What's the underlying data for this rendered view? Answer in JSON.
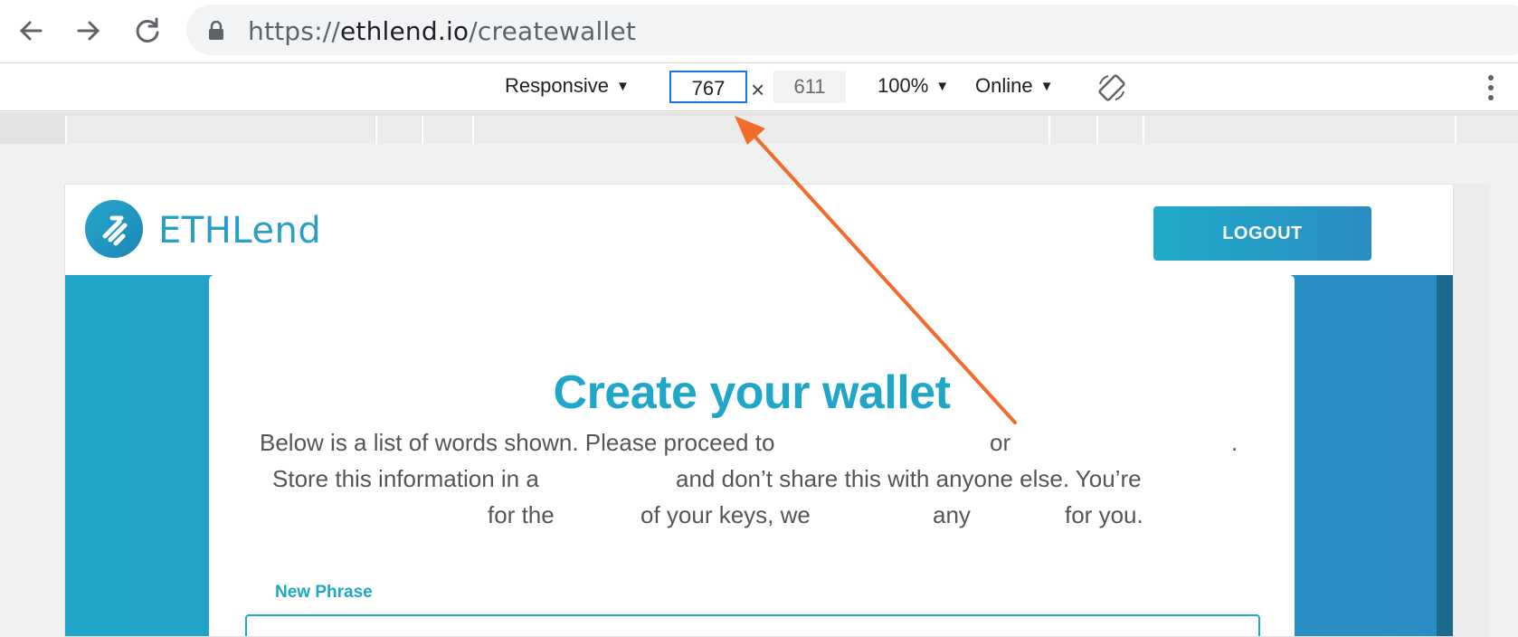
{
  "browser": {
    "url_scheme": "https://",
    "url_host": "ethlend.io",
    "url_path": "/createwallet"
  },
  "device_toolbar": {
    "mode": "Responsive",
    "width": "767",
    "times": "×",
    "height": "611",
    "zoom": "100%",
    "network": "Online"
  },
  "app": {
    "logo_text": "ETHLend",
    "logout_label": "LOGOUT",
    "title": "Create your wallet",
    "description_lines": [
      [
        "Below is a list of words shown. Please proceed to",
        "or",
        "."
      ],
      [
        "Store this information in a",
        "and don’t share this with anyone else. You’re"
      ],
      [
        "for the",
        "of your keys, we",
        "any",
        "for you."
      ]
    ],
    "field_label": "New Phrase"
  },
  "colors": {
    "brand": "#1fa6c9",
    "arrow": "#f26b2a",
    "focus": "#1a73e8"
  }
}
